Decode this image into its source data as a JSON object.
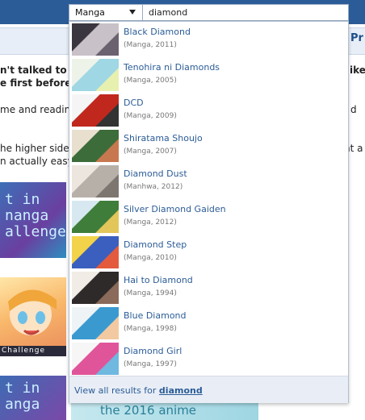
{
  "search": {
    "category": "Manga",
    "query": "diamond"
  },
  "results": [
    {
      "title": "Black Diamond",
      "meta": "(Manga, 2011)",
      "thumb_colors": [
        "#3a3640",
        "#c8c2c8",
        "#6b6270"
      ]
    },
    {
      "title": "Tenohira ni Diamonds",
      "meta": "(Manga, 2005)",
      "thumb_colors": [
        "#eef3ea",
        "#9fd7e4",
        "#e8f0b0"
      ]
    },
    {
      "title": "DCD",
      "meta": "(Manga, 2009)",
      "thumb_colors": [
        "#f5f5f5",
        "#c0281e",
        "#333333"
      ]
    },
    {
      "title": "Shiratama Shoujo",
      "meta": "(Manga, 2007)",
      "thumb_colors": [
        "#e9dfcf",
        "#3c6c3a",
        "#c8784e"
      ]
    },
    {
      "title": "Diamond Dust",
      "meta": "(Manhwa, 2012)",
      "thumb_colors": [
        "#ece6df",
        "#b7b0a9",
        "#7d7670"
      ]
    },
    {
      "title": "Silver Diamond Gaiden",
      "meta": "(Manga, 2012)",
      "thumb_colors": [
        "#d7e8f0",
        "#3f7d3a",
        "#e2c65a"
      ]
    },
    {
      "title": "Diamond Step",
      "meta": "(Manga, 2010)",
      "thumb_colors": [
        "#f2d34a",
        "#3a5fbf",
        "#e35b3c"
      ]
    },
    {
      "title": "Hai to Diamond",
      "meta": "(Manga, 1994)",
      "thumb_colors": [
        "#f1ece6",
        "#2e2a2a",
        "#8a6a5a"
      ]
    },
    {
      "title": "Blue Diamond",
      "meta": "(Manga, 1998)",
      "thumb_colors": [
        "#eef4f6",
        "#3a9ad0",
        "#f2c9a0"
      ]
    },
    {
      "title": "Diamond Girl",
      "meta": "(Manga, 1997)",
      "thumb_colors": [
        "#f6f6f6",
        "#e0559a",
        "#6fb8e0"
      ]
    }
  ],
  "footer": {
    "prefix": "View all results for ",
    "term": "diamond"
  },
  "page": {
    "nav_link": "Pr",
    "lines": [
      {
        "left": "n't talked to y",
        "right": "ike"
      },
      {
        "left": "e first before a",
        "right": ""
      },
      {
        "left": "me and readin",
        "right": "d"
      },
      {
        "left": "he higher side",
        "right": "nt a"
      },
      {
        "left": "n actually easy",
        "right": ""
      }
    ],
    "banner1_lines": [
      "t in",
      "nanga",
      "allenge"
    ],
    "banner2_caption": "Challenge",
    "banner3_lines": [
      "t in",
      "anga"
    ],
    "banner3_right": "the 2016 anime"
  }
}
